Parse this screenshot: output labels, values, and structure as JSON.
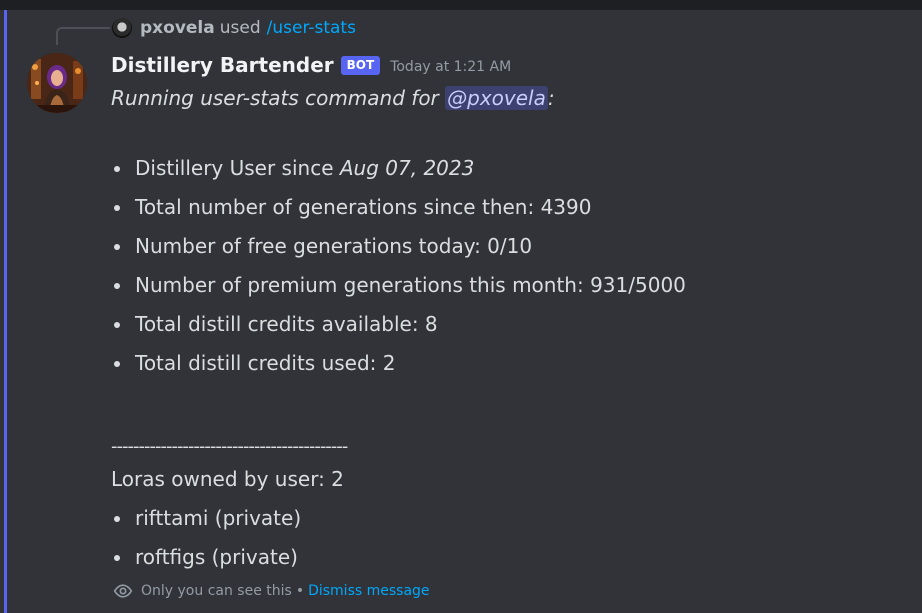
{
  "reply": {
    "user": "pxovela",
    "used_text": "used",
    "command": "/user-stats"
  },
  "message": {
    "author": "Distillery Bartender",
    "bot_tag": "BOT",
    "timestamp": "Today at 1:21 AM",
    "intro_prefix": "Running user-stats command for",
    "mention": "@pxovela",
    "intro_suffix": ":",
    "stats": [
      {
        "label": "Distillery User since ",
        "value": "Aug 07, 2023"
      },
      {
        "label": "Total number of generations since then: 4390"
      },
      {
        "label": "Number of free generations today: 0/10"
      },
      {
        "label": "Number of premium generations this month: 931/5000"
      },
      {
        "label": "Total distill credits available: 8"
      },
      {
        "label": "Total distill credits used: 2"
      }
    ],
    "divider": "-------------------------------------------",
    "loras_label": "Loras owned by user: 2",
    "loras": [
      {
        "label": "rifttami (private)"
      },
      {
        "label": "roftfigs (private)"
      }
    ]
  },
  "ephemeral": {
    "notice": "Only you can see this",
    "separator": "•",
    "dismiss": "Dismiss message"
  },
  "colors": {
    "background": "#313338",
    "accent": "#5865f2",
    "link": "#00a8fc",
    "muted": "#949ba4"
  },
  "icons": {
    "reply_avatar": "user-avatar-icon",
    "bot_avatar": "bartender-avatar",
    "ephemeral": "eye-icon"
  }
}
